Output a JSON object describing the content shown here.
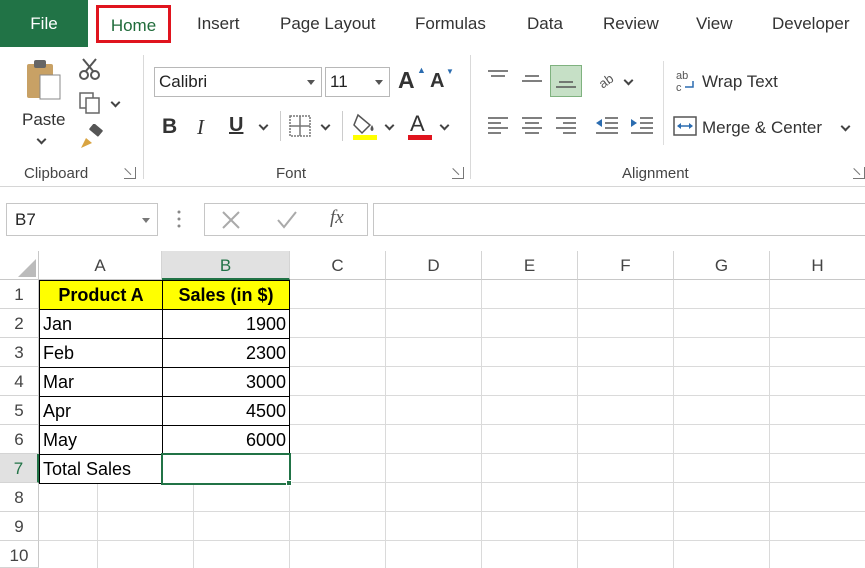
{
  "tabs": {
    "file": "File",
    "home": "Home",
    "insert": "Insert",
    "page_layout": "Page Layout",
    "formulas": "Formulas",
    "data": "Data",
    "review": "Review",
    "view": "View",
    "developer": "Developer"
  },
  "ribbon": {
    "clipboard": {
      "paste_label": "Paste",
      "group_label": "Clipboard"
    },
    "font": {
      "font_name": "Calibri",
      "font_size": "11",
      "bold": "B",
      "italic": "I",
      "underline": "U",
      "grow": "A",
      "shrink": "A",
      "font_color": "A",
      "group_label": "Font"
    },
    "alignment": {
      "wrap_text": "Wrap Text",
      "merge_center": "Merge & Center",
      "group_label": "Alignment"
    }
  },
  "formula_bar": {
    "name_box": "B7",
    "fx": "fx",
    "value": ""
  },
  "sheet": {
    "columns": [
      "A",
      "B",
      "C",
      "D",
      "E",
      "F",
      "G",
      "H"
    ],
    "rows": [
      "1",
      "2",
      "3",
      "4",
      "5",
      "6",
      "7",
      "8",
      "9",
      "10"
    ],
    "table": {
      "header": [
        "Product A",
        "Sales (in $)"
      ],
      "data": [
        [
          "Jan",
          "1900"
        ],
        [
          "Feb",
          "2300"
        ],
        [
          "Mar",
          "3000"
        ],
        [
          "Apr",
          "4500"
        ],
        [
          "May",
          "6000"
        ],
        [
          "Total Sales",
          ""
        ]
      ]
    },
    "selected_cell": "B7"
  },
  "colors": {
    "excel_green": "#217346",
    "highlight_yellow": "#ffff00",
    "font_red": "#e0141e",
    "home_outline": "#e0141e"
  }
}
